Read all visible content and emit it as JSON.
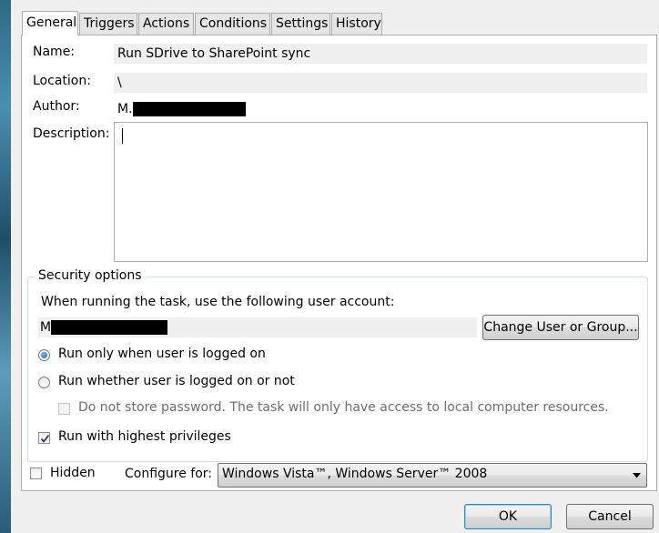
{
  "tabs": [
    {
      "label": "General",
      "active": true
    },
    {
      "label": "Triggers"
    },
    {
      "label": "Actions"
    },
    {
      "label": "Conditions"
    },
    {
      "label": "Settings"
    },
    {
      "label": "History"
    }
  ],
  "general": {
    "name_label": "Name:",
    "name_value": "Run SDrive to SharePoint sync",
    "location_label": "Location:",
    "location_value": "\\",
    "author_label": "Author:",
    "author_value": "M.",
    "description_label": "Description:",
    "description_value": ""
  },
  "security": {
    "group_label": "Security options",
    "account_prompt": "When running the task, use the following user account:",
    "account_value": "M",
    "change_button": "Change User or Group...",
    "radio_logged_on": {
      "label": "Run only when user is logged on",
      "selected": true
    },
    "radio_whether": {
      "label": "Run whether user is logged on or not",
      "selected": false
    },
    "no_store_password": {
      "label": "Do not store password.  The task will only have access to local computer resources.",
      "checked": false,
      "enabled": false
    },
    "highest_privileges": {
      "label": "Run with highest privileges",
      "checked": true
    }
  },
  "bottom": {
    "hidden": {
      "label": "Hidden",
      "checked": false
    },
    "configure_label": "Configure for:",
    "configure_value": "Windows Vista™, Windows Server™ 2008"
  },
  "buttons": {
    "ok": "OK",
    "cancel": "Cancel"
  },
  "colors": {
    "tab_border": "#adadad",
    "readonly_field_bg": "#f0f0f0",
    "redaction": "#000000",
    "default_button_border": "#3c7fb1"
  }
}
